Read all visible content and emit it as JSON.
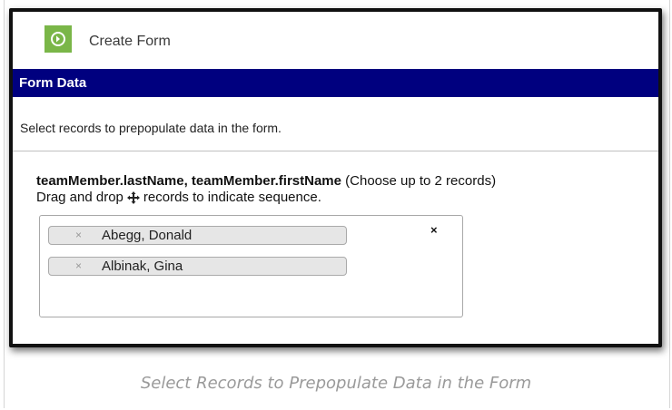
{
  "toolbar": {
    "create_label": "Create Form",
    "create_icon": "arrow-circle-right-icon"
  },
  "section": {
    "title": "Form Data",
    "instructions": "Select records to prepopulate data in the form."
  },
  "field": {
    "label_bold": "teamMember.lastName, teamMember.firstName",
    "label_note": "(Choose up to 2 records)",
    "drag_prefix": "Drag and drop",
    "drag_suffix": "records to indicate sequence.",
    "drag_icon": "move-icon"
  },
  "selected_records": [
    {
      "remove": "×",
      "label": "Abegg, Donald"
    },
    {
      "remove": "×",
      "label": "Albinak, Gina"
    }
  ],
  "clear_all": "×",
  "caption": "Select Records to Prepopulate Data in the Form",
  "colors": {
    "header_bg": "#00007f",
    "button_green": "#7ab648"
  }
}
